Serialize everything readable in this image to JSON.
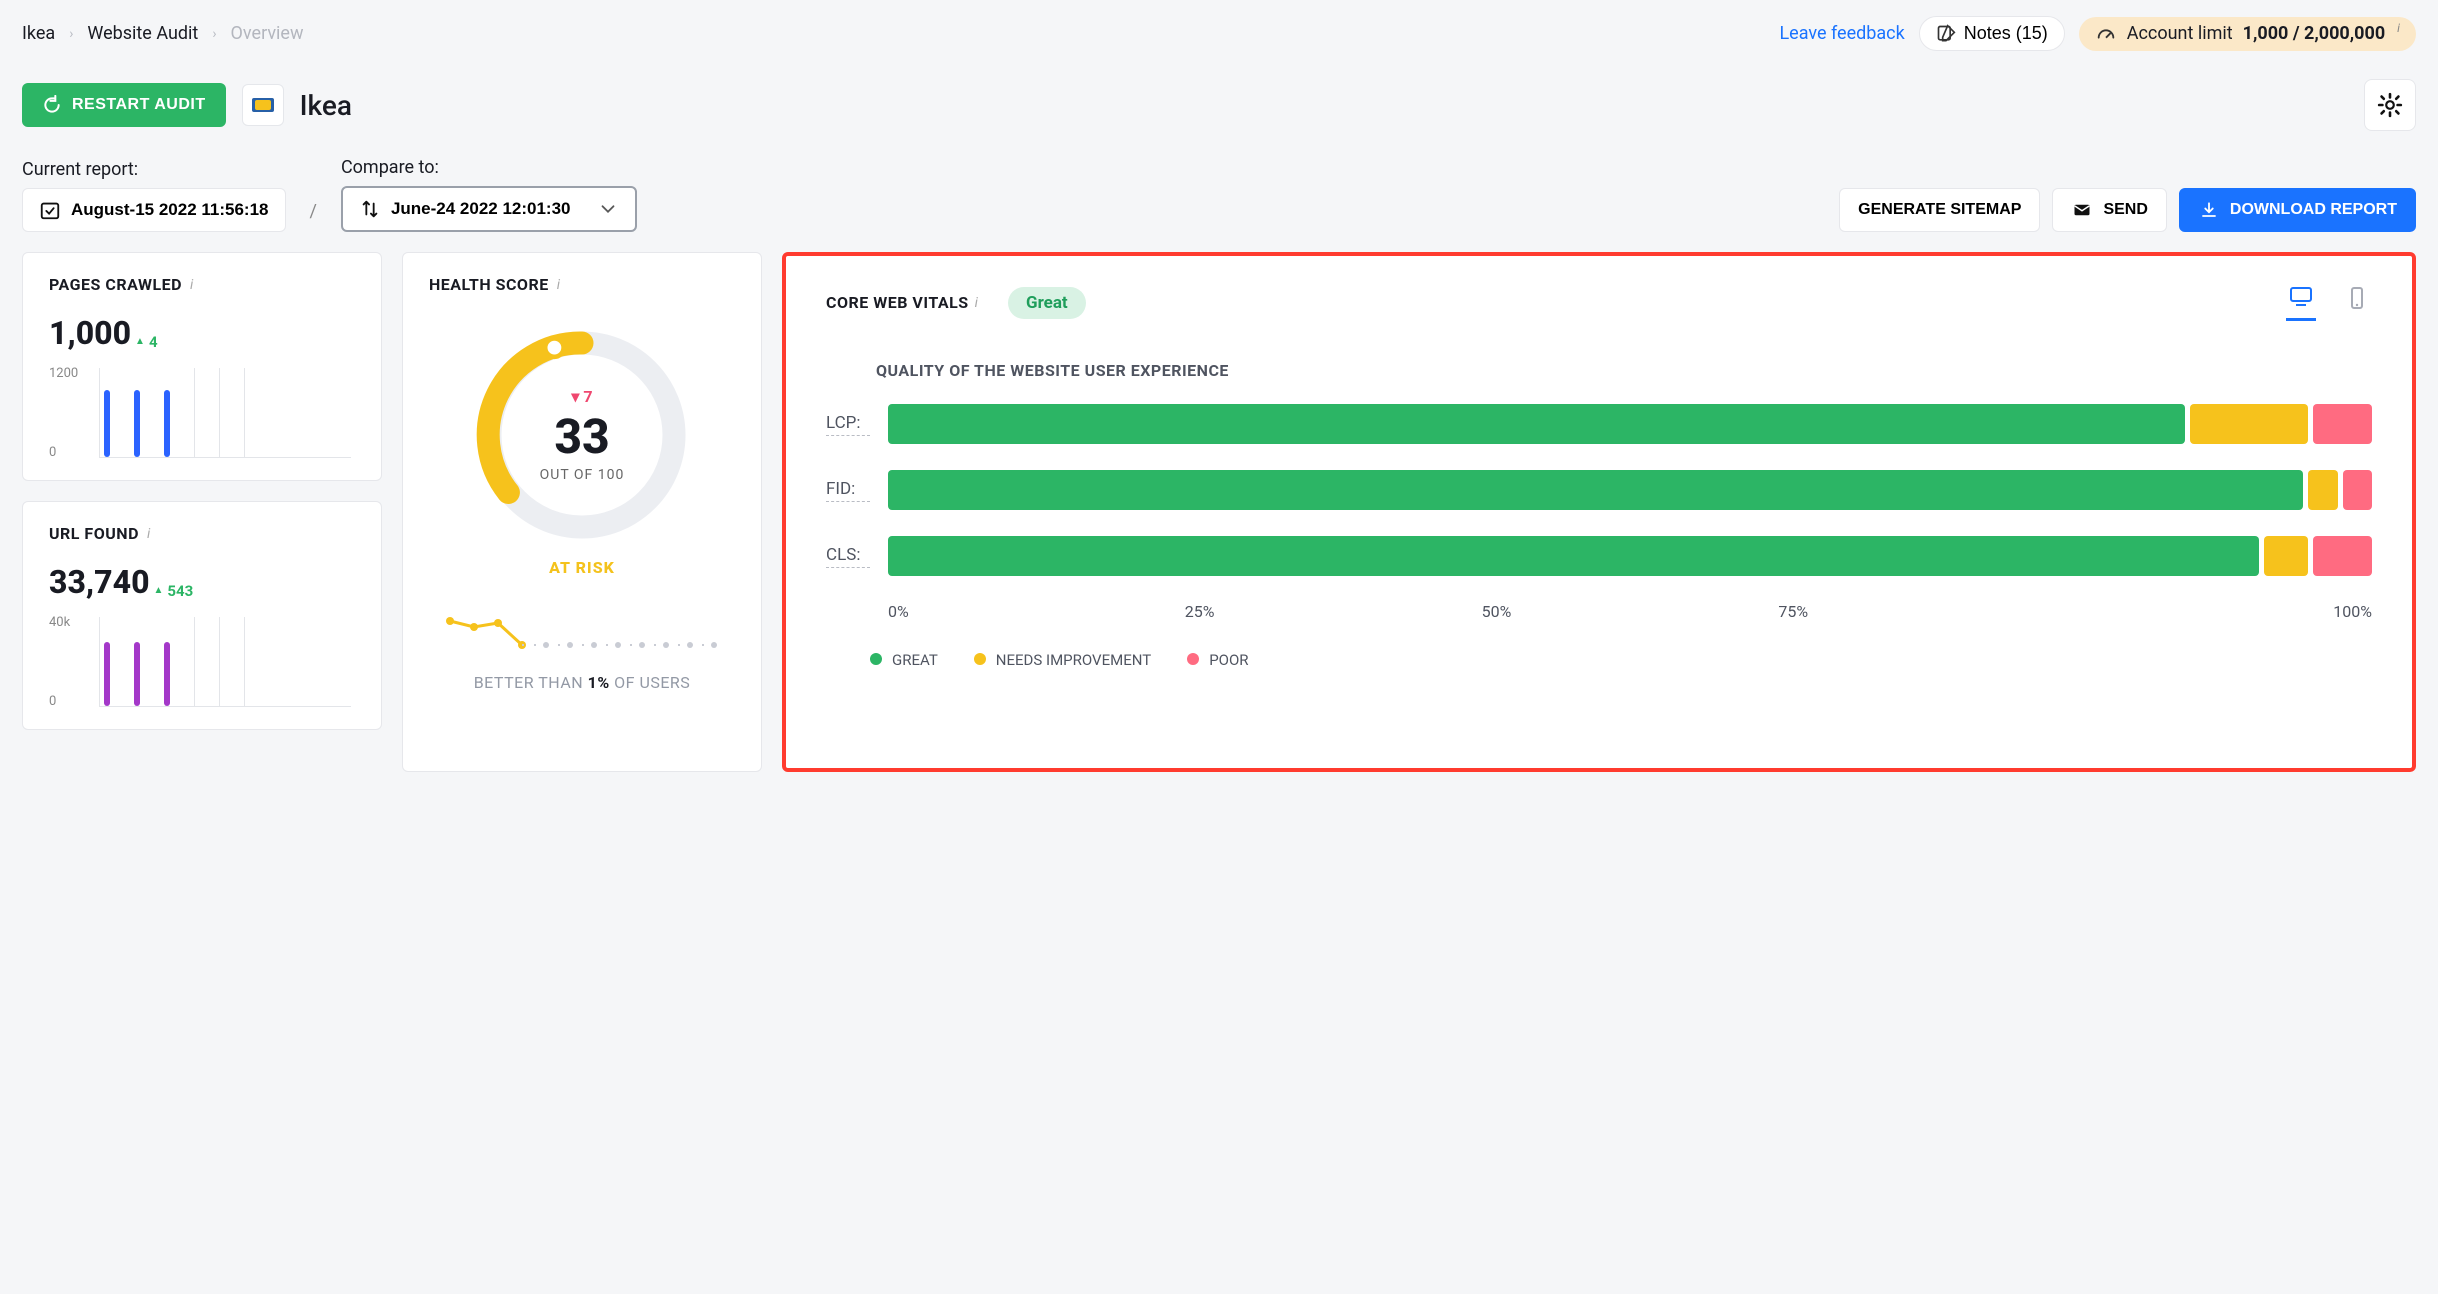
{
  "breadcrumb": {
    "a": "Ikea",
    "b": "Website Audit",
    "c": "Overview"
  },
  "top": {
    "feedback": "Leave feedback",
    "notes": "Notes (15)",
    "limit_label": "Account limit",
    "limit_value": "1,000 / 2,000,000"
  },
  "header": {
    "restart": "RESTART AUDIT",
    "project": "Ikea"
  },
  "report": {
    "current_label": "Current report:",
    "current_value": "August-15 2022 11:56:18",
    "compare_label": "Compare to:",
    "compare_value": "June-24 2022 12:01:30",
    "generate": "GENERATE SITEMAP",
    "send": "SEND",
    "download": "DOWNLOAD REPORT"
  },
  "pages_crawled": {
    "title": "PAGES CRAWLED",
    "value": "1,000",
    "delta": "4",
    "ytop": "1200",
    "ybottom": "0"
  },
  "url_found": {
    "title": "URL FOUND",
    "value": "33,740",
    "delta": "543",
    "ytop": "40k",
    "ybottom": "0"
  },
  "health": {
    "title": "HEALTH SCORE",
    "delta": "7",
    "score": "33",
    "out_of": "OUT OF 100",
    "status": "AT RISK",
    "better_prefix": "BETTER THAN",
    "better_pct": "1%",
    "better_suffix": "OF USERS"
  },
  "cwv": {
    "title": "CORE WEB VITALS",
    "status": "Great",
    "subtitle": "QUALITY OF THE WEBSITE USER EXPERIENCE",
    "labels": {
      "lcp": "LCP:",
      "fid": "FID:",
      "cls": "CLS:"
    },
    "axis": [
      "0%",
      "25%",
      "50%",
      "75%",
      "100%"
    ],
    "legend": {
      "g": "GREAT",
      "y": "NEEDS IMPROVEMENT",
      "r": "POOR"
    }
  },
  "chart_data": {
    "type": "bar",
    "title": "Core Web Vitals — Quality of the website user experience",
    "series": [
      {
        "name": "LCP",
        "great": 88,
        "needs_improvement": 8,
        "poor": 4
      },
      {
        "name": "FID",
        "great": 96,
        "needs_improvement": 2,
        "poor": 2
      },
      {
        "name": "CLS",
        "great": 93,
        "needs_improvement": 3,
        "poor": 4
      }
    ],
    "xaxis_percent": [
      0,
      25,
      50,
      75,
      100
    ]
  }
}
